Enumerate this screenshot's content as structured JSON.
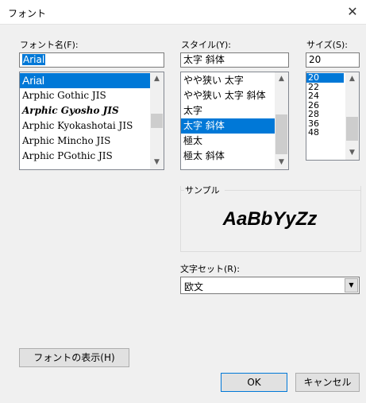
{
  "window": {
    "title": "フォント"
  },
  "font": {
    "label": "フォント名(F):",
    "value": "Arial",
    "items": [
      {
        "label": "Arial",
        "selected": true
      },
      {
        "label": "Arphic Gothic JIS"
      },
      {
        "label": "Arphic Gyosho JIS",
        "script": true
      },
      {
        "label": "Arphic Kyokashotai JIS"
      },
      {
        "label": "Arphic Mincho JIS"
      },
      {
        "label": "Arphic PGothic JIS"
      }
    ]
  },
  "style": {
    "label": "スタイル(Y):",
    "value": "太字 斜体",
    "items": [
      {
        "label": "やや狭い 太字"
      },
      {
        "label": "やや狭い 太字 斜体"
      },
      {
        "label": "太字"
      },
      {
        "label": "太字 斜体",
        "selected": true
      },
      {
        "label": "極太"
      },
      {
        "label": "極太 斜体"
      }
    ]
  },
  "size": {
    "label": "サイズ(S):",
    "value": "20",
    "items": [
      {
        "label": "20",
        "selected": true
      },
      {
        "label": "22"
      },
      {
        "label": "24"
      },
      {
        "label": "26"
      },
      {
        "label": "28"
      },
      {
        "label": "36"
      },
      {
        "label": "48"
      }
    ]
  },
  "sample": {
    "label": "サンプル",
    "text": "AaBbYyZz"
  },
  "charset": {
    "label": "文字セット(R):",
    "value": "欧文"
  },
  "buttons": {
    "show_fonts": "フォントの表示(H)",
    "ok": "OK",
    "cancel": "キャンセル"
  },
  "colors": {
    "selection": "#0078d7",
    "background": "#f0f0f0"
  }
}
